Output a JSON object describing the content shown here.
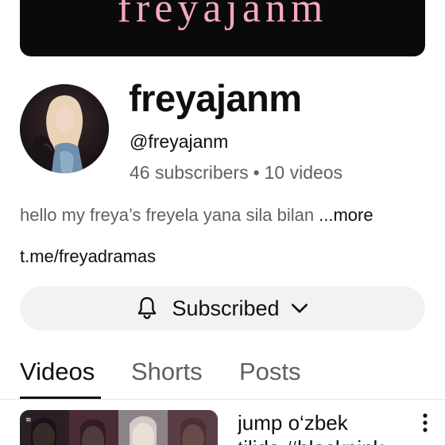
{
  "banner": {
    "text": "freyajanm"
  },
  "channel": {
    "name": "freyajanm",
    "handle": "@freyajanm",
    "subscribers": "46 subscribers",
    "separator": "•",
    "videos": "10 videos",
    "description": "hello my freya’s freyela yana sila bilan",
    "more_label": "...more",
    "link": "t.me/freyadramas"
  },
  "subscribe_button": {
    "label": "Subscribed",
    "icon": "bell-icon",
    "dropdown_icon": "chevron-down-icon"
  },
  "tabs": [
    {
      "label": "Videos",
      "active": true
    },
    {
      "label": "Shorts",
      "active": false
    },
    {
      "label": "Posts",
      "active": false
    }
  ],
  "videos": [
    {
      "title_line1": "jump o‘zbek",
      "title_line2": "tilida #blackpink"
    }
  ],
  "colors": {
    "banner_bg": "#0a0a0a",
    "banner_text": "#f5a6c6",
    "secondary_text": "#606060",
    "button_bg": "#f2f2f2"
  }
}
